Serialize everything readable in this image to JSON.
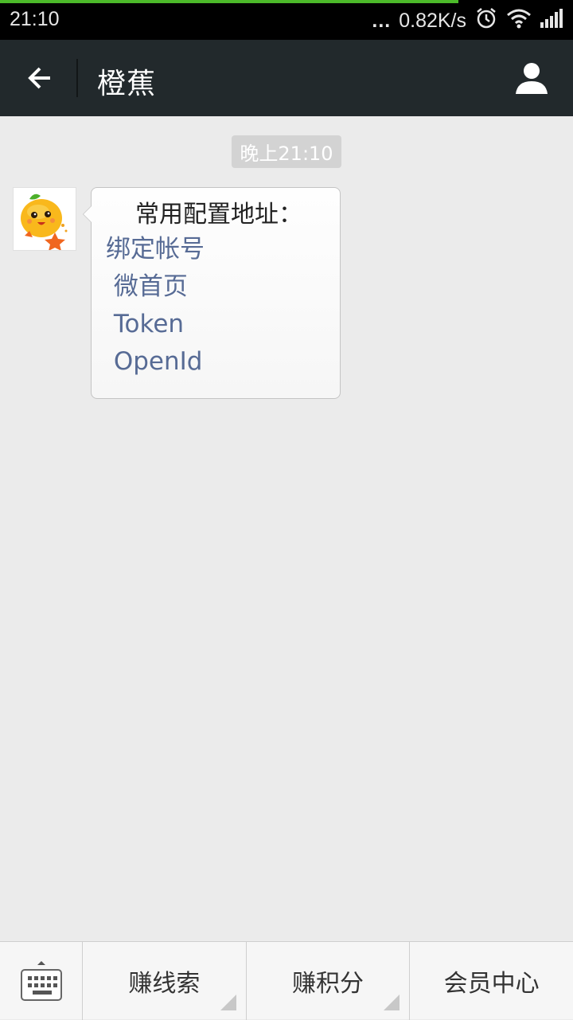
{
  "status_bar": {
    "time": "21:10",
    "dots": "...",
    "net_speed": "0.82K/s",
    "icons": [
      "alarm-icon",
      "wifi-icon",
      "signal-icon"
    ]
  },
  "header": {
    "title": "橙蕉",
    "back_icon": "arrow-left-icon",
    "profile_icon": "person-icon"
  },
  "chat": {
    "timestamp": "晚上21:10",
    "message": {
      "heading": "常用配置地址：",
      "links": [
        {
          "label": "绑定帐号"
        },
        {
          "label": " 微首页"
        },
        {
          "label": " Token"
        },
        {
          "label": " OpenId"
        }
      ]
    }
  },
  "bottom_menu": {
    "keyboard_icon": "keyboard-icon",
    "items": [
      {
        "label": "赚线索",
        "has_submenu": true
      },
      {
        "label": "赚积分",
        "has_submenu": true
      },
      {
        "label": "会员中心",
        "has_submenu": false
      }
    ]
  },
  "colors": {
    "title_bar": "#22292c",
    "link": "#576b95",
    "progress": "#4cba2a",
    "background": "#ebebeb"
  }
}
